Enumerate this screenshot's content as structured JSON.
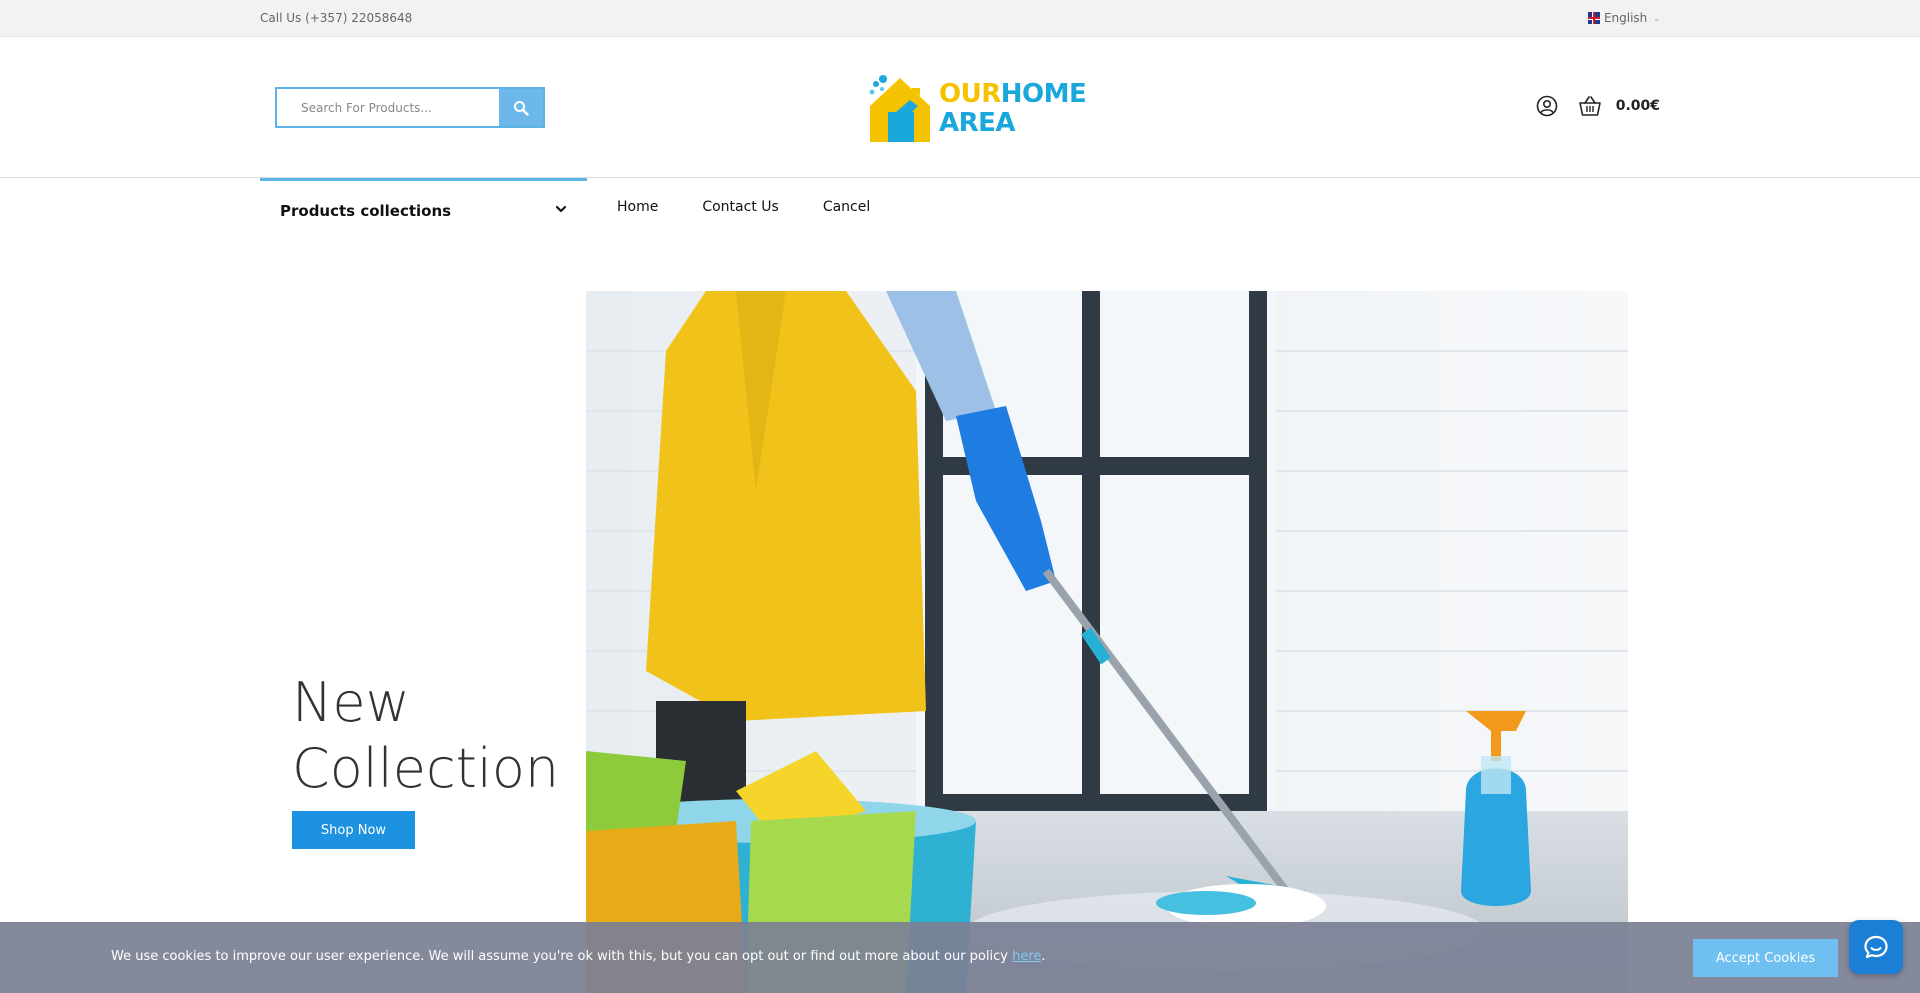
{
  "topbar": {
    "call": "Call Us (+357) 22058648",
    "language": "English"
  },
  "header": {
    "search_placeholder": "Search For Products...",
    "logo": {
      "our": "OUR",
      "home": "HOME",
      "area": "AREA"
    },
    "cart_total": "0.00€"
  },
  "nav": {
    "category_label": "Products collections",
    "items": [
      "Home",
      "Contact Us",
      "Cancel"
    ]
  },
  "hero": {
    "title_line1": "New",
    "title_line2": "Collection",
    "cta": "Shop Now"
  },
  "cookie": {
    "message": "We use cookies to improve our user experience. We will assume you're ok with this, but you can opt out or find out more about our policy ",
    "link": "here",
    "suffix": ".",
    "accept": "Accept Cookies"
  },
  "colors": {
    "accent": "#1c92e0",
    "logo_yellow": "#f5c200",
    "logo_blue": "#1aa8dc"
  }
}
